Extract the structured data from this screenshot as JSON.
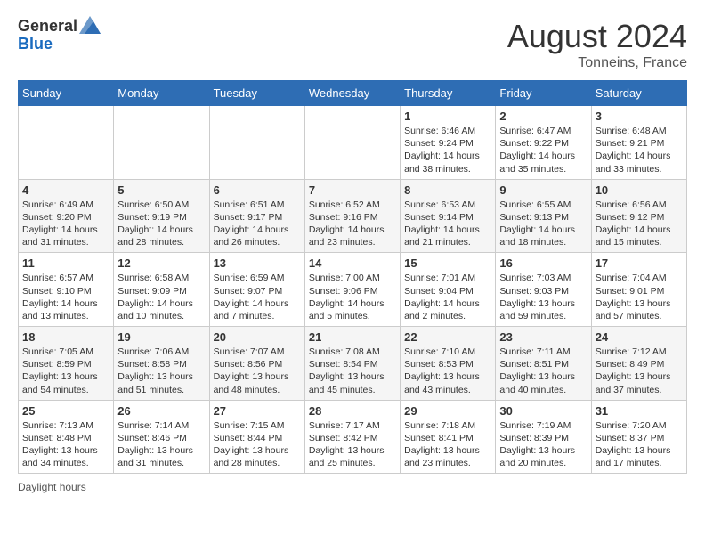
{
  "header": {
    "logo_general": "General",
    "logo_blue": "Blue",
    "month_year": "August 2024",
    "location": "Tonneins, France"
  },
  "days_of_week": [
    "Sunday",
    "Monday",
    "Tuesday",
    "Wednesday",
    "Thursday",
    "Friday",
    "Saturday"
  ],
  "weeks": [
    [
      {
        "day": "",
        "info": ""
      },
      {
        "day": "",
        "info": ""
      },
      {
        "day": "",
        "info": ""
      },
      {
        "day": "",
        "info": ""
      },
      {
        "day": "1",
        "info": "Sunrise: 6:46 AM\nSunset: 9:24 PM\nDaylight: 14 hours\nand 38 minutes."
      },
      {
        "day": "2",
        "info": "Sunrise: 6:47 AM\nSunset: 9:22 PM\nDaylight: 14 hours\nand 35 minutes."
      },
      {
        "day": "3",
        "info": "Sunrise: 6:48 AM\nSunset: 9:21 PM\nDaylight: 14 hours\nand 33 minutes."
      }
    ],
    [
      {
        "day": "4",
        "info": "Sunrise: 6:49 AM\nSunset: 9:20 PM\nDaylight: 14 hours\nand 31 minutes."
      },
      {
        "day": "5",
        "info": "Sunrise: 6:50 AM\nSunset: 9:19 PM\nDaylight: 14 hours\nand 28 minutes."
      },
      {
        "day": "6",
        "info": "Sunrise: 6:51 AM\nSunset: 9:17 PM\nDaylight: 14 hours\nand 26 minutes."
      },
      {
        "day": "7",
        "info": "Sunrise: 6:52 AM\nSunset: 9:16 PM\nDaylight: 14 hours\nand 23 minutes."
      },
      {
        "day": "8",
        "info": "Sunrise: 6:53 AM\nSunset: 9:14 PM\nDaylight: 14 hours\nand 21 minutes."
      },
      {
        "day": "9",
        "info": "Sunrise: 6:55 AM\nSunset: 9:13 PM\nDaylight: 14 hours\nand 18 minutes."
      },
      {
        "day": "10",
        "info": "Sunrise: 6:56 AM\nSunset: 9:12 PM\nDaylight: 14 hours\nand 15 minutes."
      }
    ],
    [
      {
        "day": "11",
        "info": "Sunrise: 6:57 AM\nSunset: 9:10 PM\nDaylight: 14 hours\nand 13 minutes."
      },
      {
        "day": "12",
        "info": "Sunrise: 6:58 AM\nSunset: 9:09 PM\nDaylight: 14 hours\nand 10 minutes."
      },
      {
        "day": "13",
        "info": "Sunrise: 6:59 AM\nSunset: 9:07 PM\nDaylight: 14 hours\nand 7 minutes."
      },
      {
        "day": "14",
        "info": "Sunrise: 7:00 AM\nSunset: 9:06 PM\nDaylight: 14 hours\nand 5 minutes."
      },
      {
        "day": "15",
        "info": "Sunrise: 7:01 AM\nSunset: 9:04 PM\nDaylight: 14 hours\nand 2 minutes."
      },
      {
        "day": "16",
        "info": "Sunrise: 7:03 AM\nSunset: 9:03 PM\nDaylight: 13 hours\nand 59 minutes."
      },
      {
        "day": "17",
        "info": "Sunrise: 7:04 AM\nSunset: 9:01 PM\nDaylight: 13 hours\nand 57 minutes."
      }
    ],
    [
      {
        "day": "18",
        "info": "Sunrise: 7:05 AM\nSunset: 8:59 PM\nDaylight: 13 hours\nand 54 minutes."
      },
      {
        "day": "19",
        "info": "Sunrise: 7:06 AM\nSunset: 8:58 PM\nDaylight: 13 hours\nand 51 minutes."
      },
      {
        "day": "20",
        "info": "Sunrise: 7:07 AM\nSunset: 8:56 PM\nDaylight: 13 hours\nand 48 minutes."
      },
      {
        "day": "21",
        "info": "Sunrise: 7:08 AM\nSunset: 8:54 PM\nDaylight: 13 hours\nand 45 minutes."
      },
      {
        "day": "22",
        "info": "Sunrise: 7:10 AM\nSunset: 8:53 PM\nDaylight: 13 hours\nand 43 minutes."
      },
      {
        "day": "23",
        "info": "Sunrise: 7:11 AM\nSunset: 8:51 PM\nDaylight: 13 hours\nand 40 minutes."
      },
      {
        "day": "24",
        "info": "Sunrise: 7:12 AM\nSunset: 8:49 PM\nDaylight: 13 hours\nand 37 minutes."
      }
    ],
    [
      {
        "day": "25",
        "info": "Sunrise: 7:13 AM\nSunset: 8:48 PM\nDaylight: 13 hours\nand 34 minutes."
      },
      {
        "day": "26",
        "info": "Sunrise: 7:14 AM\nSunset: 8:46 PM\nDaylight: 13 hours\nand 31 minutes."
      },
      {
        "day": "27",
        "info": "Sunrise: 7:15 AM\nSunset: 8:44 PM\nDaylight: 13 hours\nand 28 minutes."
      },
      {
        "day": "28",
        "info": "Sunrise: 7:17 AM\nSunset: 8:42 PM\nDaylight: 13 hours\nand 25 minutes."
      },
      {
        "day": "29",
        "info": "Sunrise: 7:18 AM\nSunset: 8:41 PM\nDaylight: 13 hours\nand 23 minutes."
      },
      {
        "day": "30",
        "info": "Sunrise: 7:19 AM\nSunset: 8:39 PM\nDaylight: 13 hours\nand 20 minutes."
      },
      {
        "day": "31",
        "info": "Sunrise: 7:20 AM\nSunset: 8:37 PM\nDaylight: 13 hours\nand 17 minutes."
      }
    ]
  ],
  "footer": {
    "note": "Daylight hours"
  }
}
